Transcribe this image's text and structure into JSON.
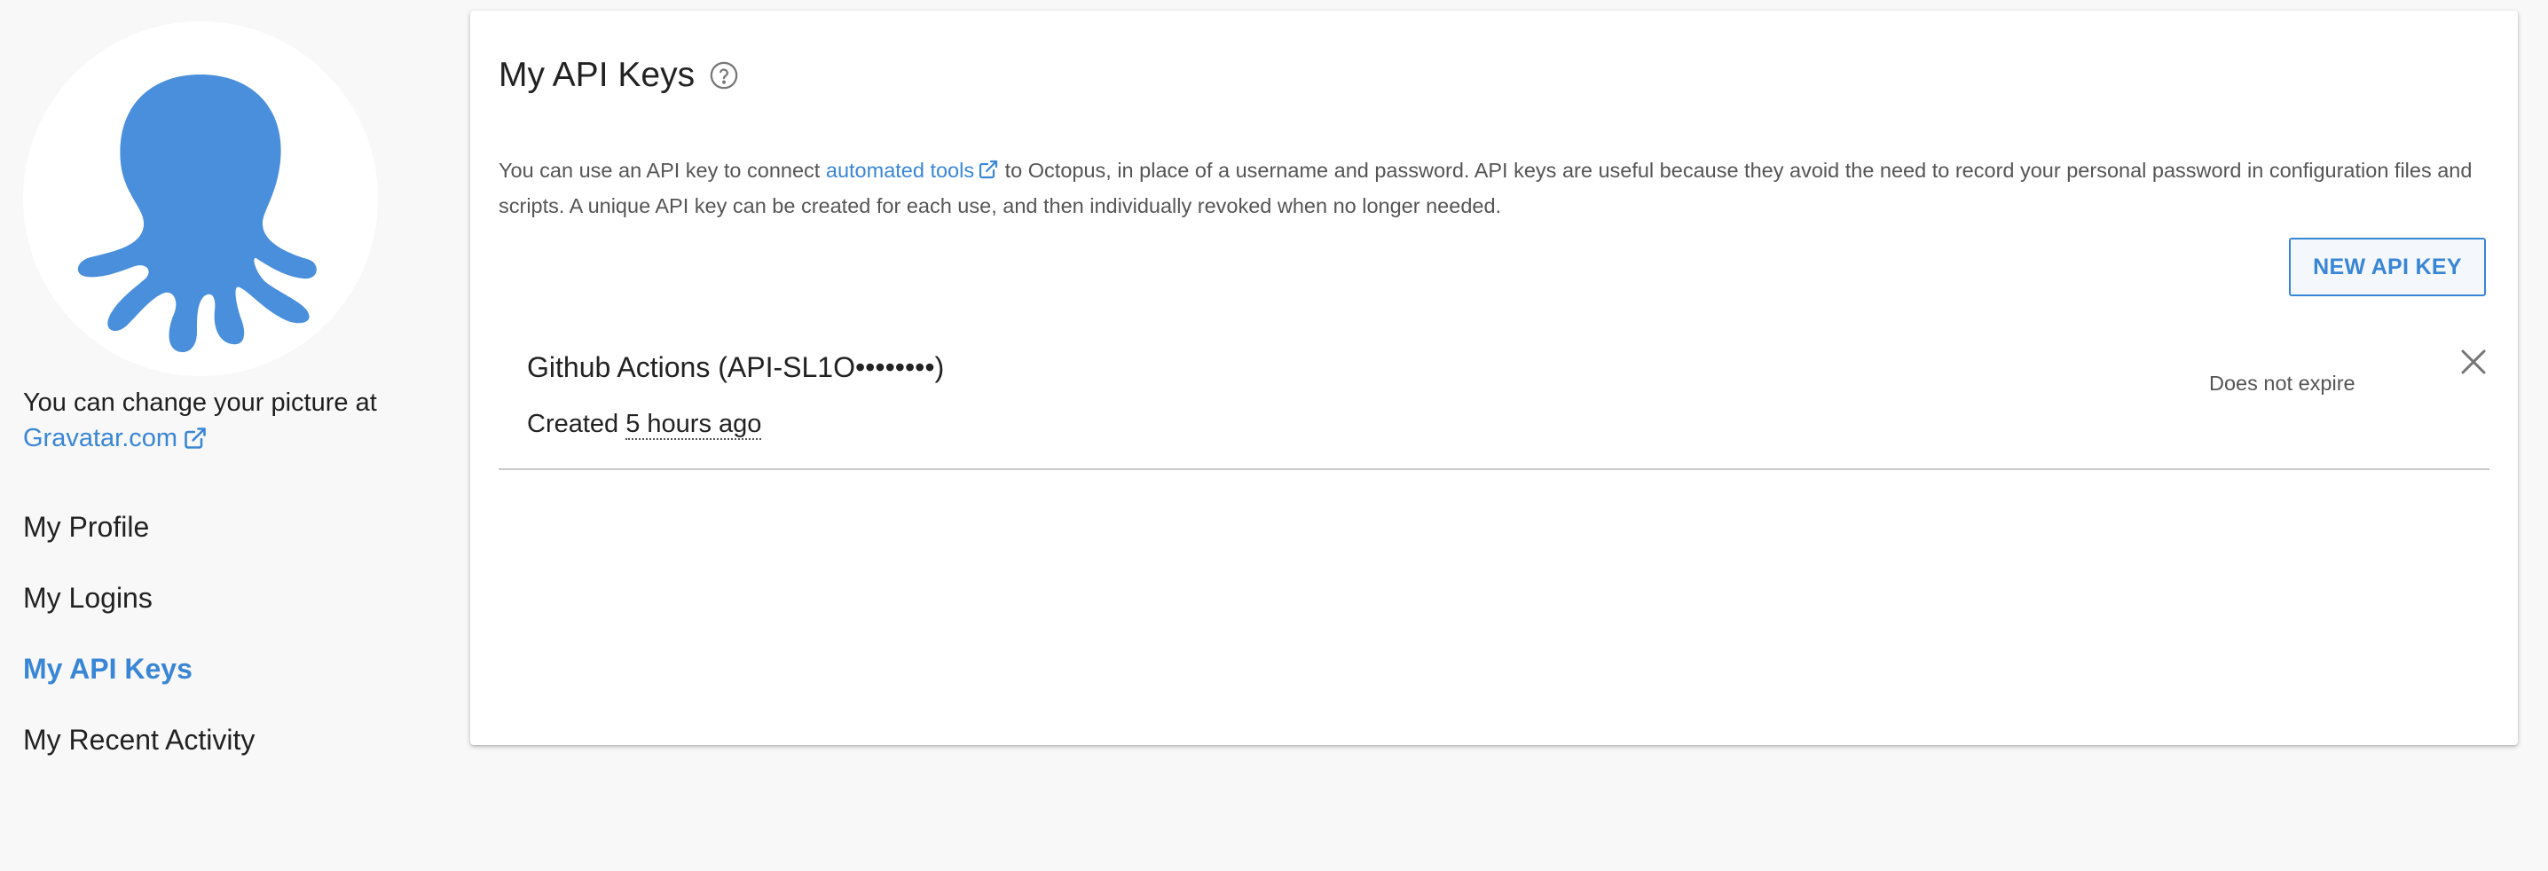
{
  "sidebar": {
    "avatar_icon": "octopus-logo-icon",
    "change_picture_text": "You can change your picture at",
    "gravatar_link": "Gravatar.com",
    "nav_items": [
      {
        "label": "My Profile",
        "active": false
      },
      {
        "label": "My Logins",
        "active": false
      },
      {
        "label": "My API Keys",
        "active": true
      },
      {
        "label": "My Recent Activity",
        "active": false
      }
    ]
  },
  "main": {
    "title": "My API Keys",
    "help_icon": "question-circle-icon",
    "description": {
      "before_link": "You can use an API key to connect ",
      "link_text": "automated tools",
      "after_link": " to Octopus, in place of a username and password. API keys are useful because they avoid the need to record your personal password in configuration files and scripts. A unique API key can be created for each use, and then individually revoked when no longer needed."
    },
    "new_key_button": "NEW API KEY",
    "api_keys": [
      {
        "name": "Github Actions (API-SL1O••••••••)",
        "created_label": "Created",
        "created_time": "5 hours ago",
        "expiry": "Does not expire"
      }
    ]
  },
  "colors": {
    "accent": "#3a86d6",
    "background": "#f8f8f8",
    "card": "#ffffff"
  }
}
